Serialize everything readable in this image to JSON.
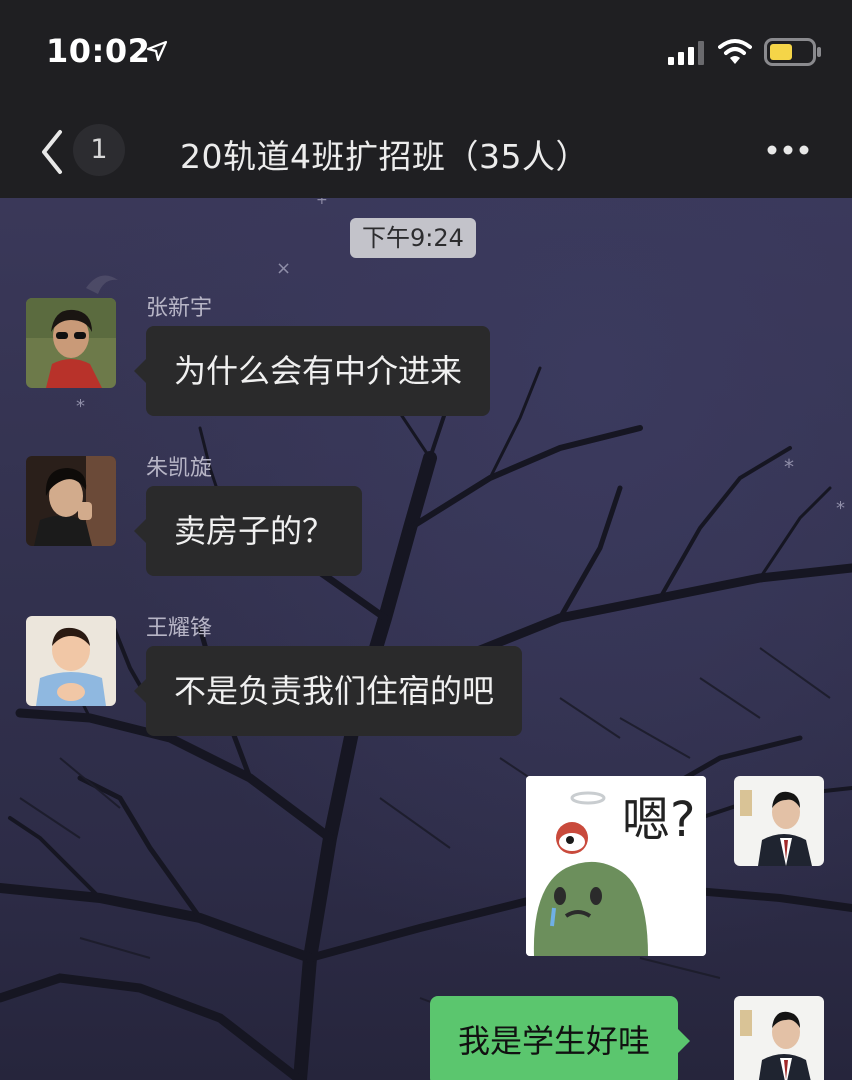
{
  "status_bar": {
    "time": "10:02",
    "icons": [
      "location-arrow-icon",
      "signal-icon",
      "wifi-icon",
      "battery-icon"
    ]
  },
  "nav": {
    "unread_count": "1",
    "title": "20轨道4班扩招班（35人）",
    "icons": [
      "back-chevron-icon",
      "more-icon"
    ]
  },
  "chat": {
    "timestamp": "下午9:24",
    "messages": [
      {
        "sender": "张新宇",
        "text": "为什么会有中介进来",
        "side": "left"
      },
      {
        "sender": "朱凯旋",
        "text": "卖房子的？",
        "side": "left"
      },
      {
        "sender": "王耀锋",
        "text": "不是负责我们住宿的吧",
        "side": "left"
      },
      {
        "sender": "",
        "text": "",
        "side": "right",
        "kind": "sticker",
        "sticker_text": "嗯?"
      },
      {
        "sender": "",
        "text": "我是学生好哇",
        "side": "right"
      }
    ]
  },
  "colors": {
    "topbar": "#1f1f22",
    "bubble_left": "#2a2a2b",
    "bubble_right": "#5bc66e",
    "battery": "#f5d548"
  }
}
